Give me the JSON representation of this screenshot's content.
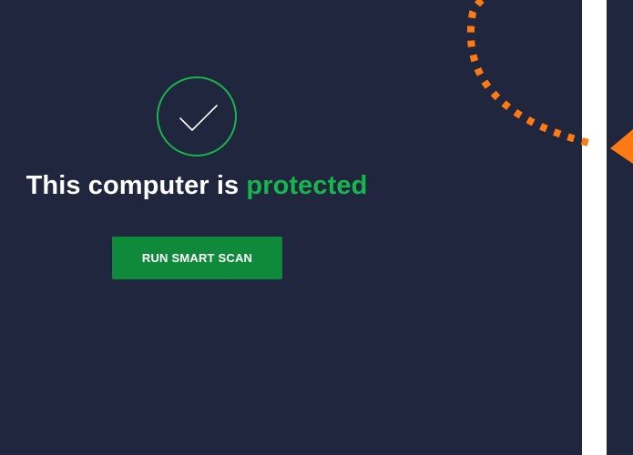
{
  "status": {
    "headline_prefix": "This computer is ",
    "headline_status": "protected",
    "status_color": "#18b54d"
  },
  "actions": {
    "scan_label": "RUN SMART SCAN",
    "scan_color": "#0f8a3a"
  },
  "icons": {
    "status": "check-icon",
    "annotation": "dotted-arrow-icon"
  },
  "colors": {
    "background": "#1f263d",
    "annotation_arrow": "#ff7a12"
  }
}
